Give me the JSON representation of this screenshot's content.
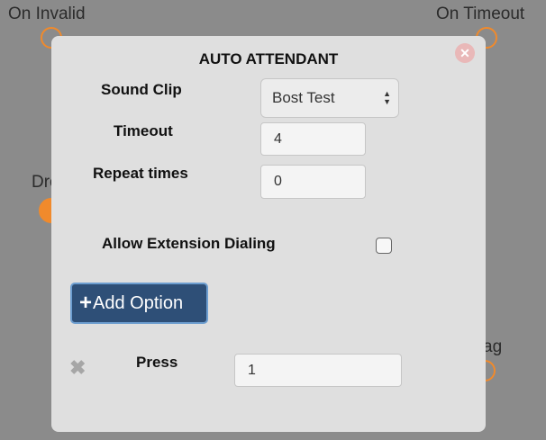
{
  "canvas": {
    "on_invalid_label": "On Invalid",
    "on_timeout_label": "On Timeout",
    "drop_label": "Drop",
    "drag_label": "Drag"
  },
  "node": {
    "title": "AUTO ATTENDANT",
    "close_icon": "close-circle-icon",
    "sound_clip": {
      "label": "Sound Clip",
      "value": "Bost Test"
    },
    "timeout": {
      "label": "Timeout",
      "value": "4"
    },
    "repeat": {
      "label": "Repeat times",
      "value": "0"
    },
    "allow_extension": {
      "label": "Allow Extension Dialing",
      "checked": false
    },
    "add_option": {
      "icon": "+",
      "label": "Add Option"
    },
    "option": {
      "remove_icon": "✖",
      "label": "Press",
      "value": "1"
    }
  },
  "colors": {
    "endpoint": "#f08a2c",
    "button": "#2e4f77",
    "panel": "#dfdfdf"
  }
}
